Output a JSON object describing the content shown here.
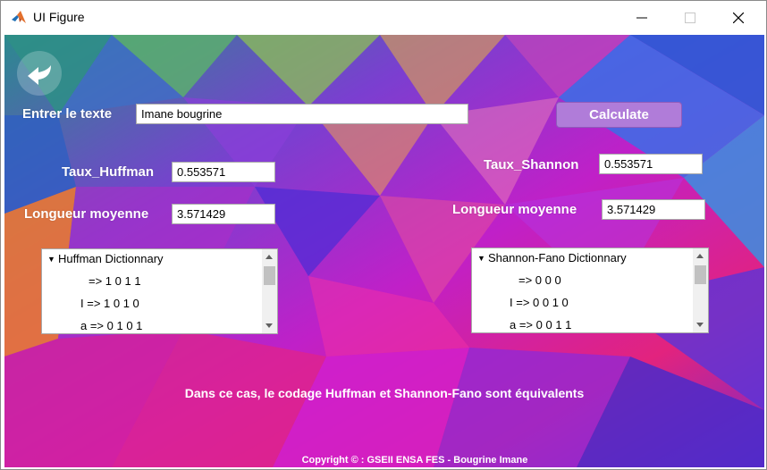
{
  "window": {
    "title": "UI Figure"
  },
  "form": {
    "text_label": "Entrer le texte",
    "text_value": "Imane bougrine",
    "calculate_label": "Calculate"
  },
  "huffman": {
    "rate_label": "Taux_Huffman",
    "rate_value": "0.553571",
    "avg_label": "Longueur moyenne",
    "avg_value": "3.571429",
    "dict_title": "Huffman Dictionnary",
    "entries": [
      "=> 1  0  1  1",
      "I => 1  0  1  0",
      "a => 0  1  0  1"
    ]
  },
  "shannon": {
    "rate_label": "Taux_Shannon",
    "rate_value": "0.553571",
    "avg_label": "Longueur moyenne",
    "avg_value": "3.571429",
    "dict_title": "Shannon-Fano Dictionnary",
    "entries": [
      "=> 0  0  0",
      "I => 0  0  1  0",
      "a => 0  0  1  1"
    ]
  },
  "message": "Dans ce cas, le codage Huffman et Shannon-Fano sont équivalents",
  "footer": "Copyright © : GSEII ENSA FES - Bougrine Imane",
  "colors": {
    "button": "#b07cd9",
    "label_text": "#ffffff",
    "bg_blue": "#2a5bd6",
    "bg_magenta": "#d21fd0",
    "bg_orange": "#f07a2a",
    "bg_purple": "#6b1fc4"
  },
  "icons": {
    "back": "back-arrow-icon",
    "app": "matlab-icon"
  }
}
